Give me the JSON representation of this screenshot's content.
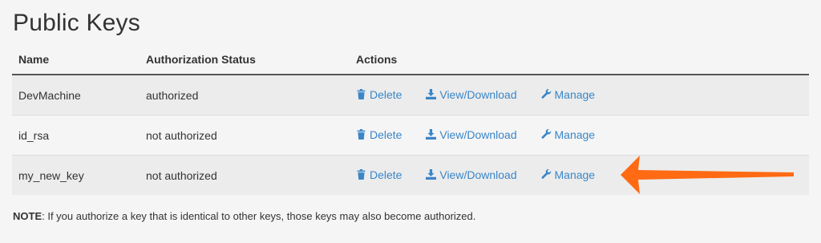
{
  "page": {
    "title": "Public Keys"
  },
  "table": {
    "headers": {
      "name": "Name",
      "status": "Authorization Status",
      "actions": "Actions"
    },
    "action_labels": {
      "delete": "Delete",
      "download": "View/Download",
      "manage": "Manage"
    },
    "rows": [
      {
        "name": "DevMachine",
        "status": "authorized"
      },
      {
        "name": "id_rsa",
        "status": "not authorized"
      },
      {
        "name": "my_new_key",
        "status": "not authorized"
      }
    ]
  },
  "note": {
    "label": "NOTE",
    "text": ": If you authorize a key that is identical to other keys, those keys may also become authorized."
  },
  "colors": {
    "link": "#3a86c8",
    "annotation_arrow": "#ff6a13"
  },
  "icons": {
    "delete": "trash-icon",
    "download": "download-icon",
    "manage": "wrench-icon"
  }
}
